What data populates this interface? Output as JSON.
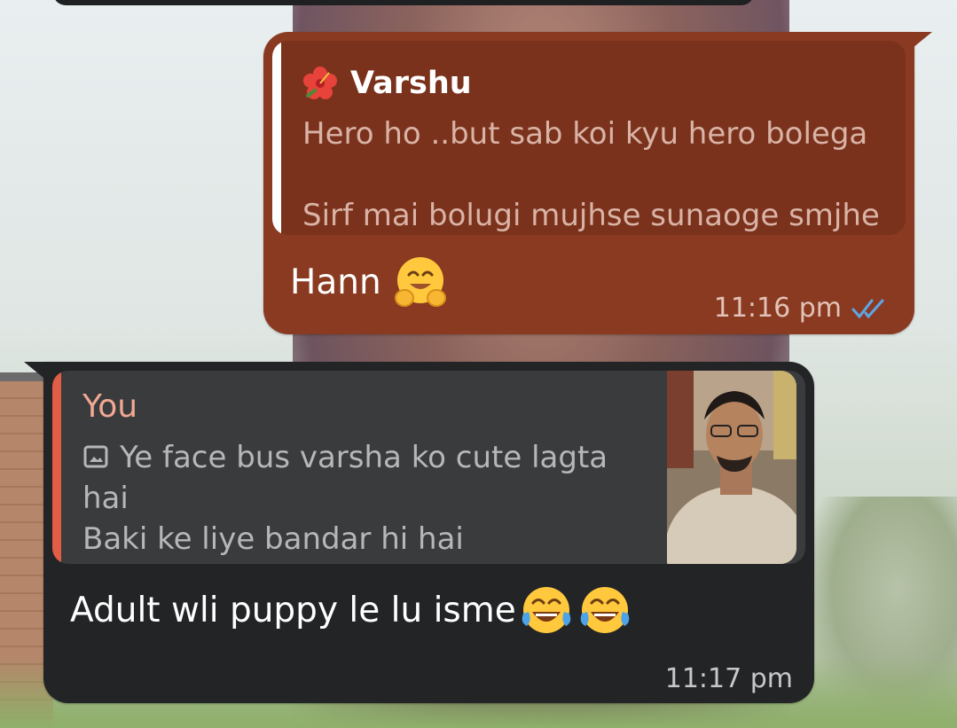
{
  "chat": {
    "outgoing": {
      "quote": {
        "sender": "Varshu",
        "text": "Hero ho ..but sab koi kyu hero bolega\n\nSirf mai bolugi mujhse sunaoge smjhe"
      },
      "text": "Hann",
      "emoji": "hugging-face",
      "time": "11:16 pm",
      "status": "read",
      "colors": {
        "bubble": "#8a3a20",
        "quote_bg": "#7a321c",
        "ticks": "#5ea7e8"
      }
    },
    "incoming": {
      "quote": {
        "sender": "You",
        "line1": "Ye face bus varsha ko cute lagta hai",
        "line2": "Baki ke liye bandar hi hai",
        "attachment": "photo"
      },
      "text": "Adult wli puppy le lu isme",
      "emoji": [
        "face-with-tears-of-joy",
        "face-with-tears-of-joy"
      ],
      "time": "11:17 pm",
      "colors": {
        "bubble": "#232426",
        "quote_bg": "#3a3b3d",
        "quote_bar": "#e25d45",
        "sender": "#f2a893"
      }
    }
  }
}
